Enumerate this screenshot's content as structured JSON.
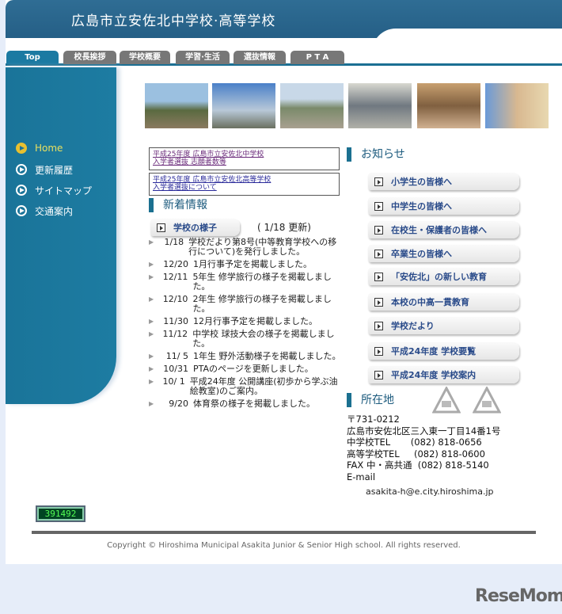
{
  "header": {
    "title": "広島市立安佐北中学校·高等学校"
  },
  "tabs": [
    "Top",
    "校長挨拶",
    "学校概要",
    "学習·生活",
    "選抜情報",
    "P T A"
  ],
  "sidebar": [
    "Home",
    "更新履歴",
    "サイトマップ",
    "交通案内"
  ],
  "links": [
    {
      "line1": "平成25年度 広島市立安佐北中学校",
      "line2": "入学者選抜 志願者数等"
    },
    {
      "line1": "平成25年度 広島市立安佐北高等学校",
      "line2": "入学者選抜について"
    }
  ],
  "news": {
    "heading": "新着情報",
    "button": "学校の様子",
    "updated": "( 1/18 更新)",
    "items": [
      {
        "date": "1/18",
        "text": "学校だより第8号(中等教育学校への移行について)を発行しました。"
      },
      {
        "date": "12/20",
        "text": "1月行事予定を掲載しました。"
      },
      {
        "date": "12/11",
        "text": "5年生 修学旅行の様子を掲載しました。"
      },
      {
        "date": "12/10",
        "text": "2年生 修学旅行の様子を掲載しました。"
      },
      {
        "date": "11/30",
        "text": "12月行事予定を掲載しました。"
      },
      {
        "date": "11/12",
        "text": "中学校 球技大会の様子を掲載しました。"
      },
      {
        "date": "11/ 5",
        "text": "1年生 野外活動様子を掲載しました。"
      },
      {
        "date": "10/31",
        "text": "PTAのページを更新しました。"
      },
      {
        "date": "10/ 1",
        "text": "平成24年度 公開講座(初歩から学ぶ油絵教室)のご案内。"
      },
      {
        "date": "9/20",
        "text": "体育祭の様子を掲載しました。"
      }
    ]
  },
  "notice": {
    "heading": "お知らせ",
    "buttons": [
      "小学生の皆様へ",
      "中学生の皆様へ",
      "在校生・保護者の皆様へ",
      "卒業生の皆様へ",
      "「安佐北」の新しい教育",
      "本校の中高一貫教育",
      "学校だより",
      "平成24年度 学校要覧",
      "平成24年度 学校案内"
    ]
  },
  "address": {
    "heading": "所在地",
    "lines": [
      "〒731-0212",
      "広島市安佐北区三入東一丁目14番1号",
      "中学校TEL       (082) 818-0656",
      "高等学校TEL     (082) 818-0600",
      "FAX 中・高共通  (082) 818-5140",
      "E-mail"
    ],
    "email": "asakita-h@e.city.hiroshima.jp"
  },
  "counter": "391492",
  "footer": {
    "copyright": "Copyright © Hiroshima Municipal Asakita Junior & Senior High school. All rights reserved."
  },
  "watermark": "ReseMom"
}
